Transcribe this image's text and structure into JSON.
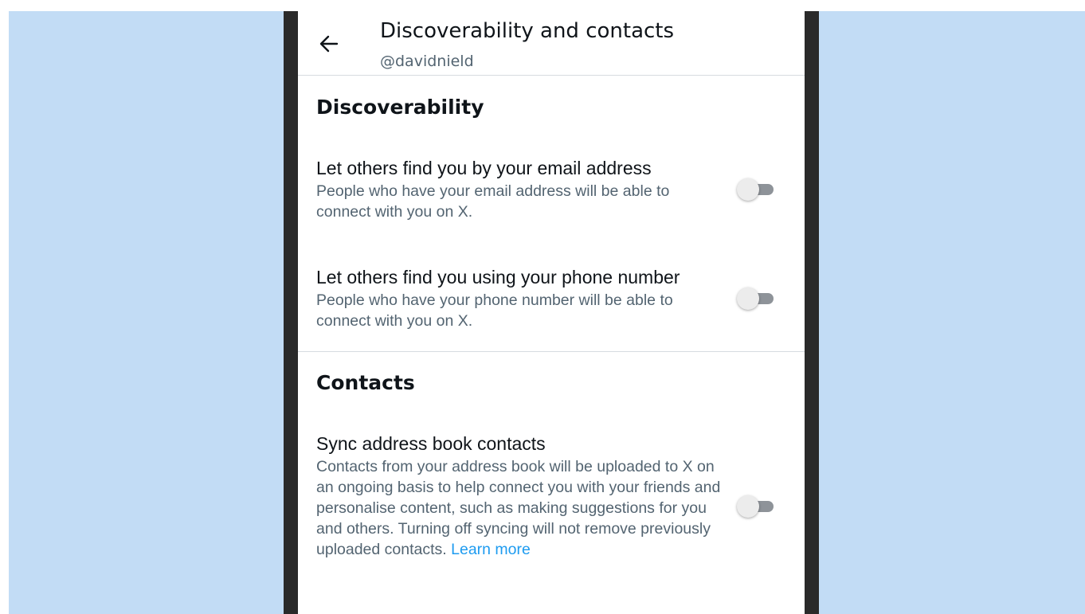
{
  "header": {
    "title": "Discoverability and contacts",
    "username": "@davidnield",
    "back_icon": "arrow-left-icon"
  },
  "discoverability": {
    "title": "Discoverability",
    "settings": [
      {
        "label": "Let others find you by your email address",
        "description": "People who have your email address will be able to connect with you on X.",
        "enabled": false
      },
      {
        "label": "Let others find you using your phone number",
        "description": "People who have your phone number will be able to connect with you on X.",
        "enabled": false
      }
    ]
  },
  "contacts": {
    "title": "Contacts",
    "settings": [
      {
        "label": "Sync address book contacts",
        "description": "Contacts from your address book will be uploaded to X on an ongoing basis to help connect you with your friends and personalise content, such as making suggestions for you and others. Turning off syncing will not remove previously uploaded contacts.",
        "link_text": "Learn more",
        "enabled": false
      }
    ]
  },
  "colors": {
    "background": "#c2dcf5",
    "frame": "#2a2a2a",
    "link": "#1d9bf0",
    "secondary_text": "#536471"
  }
}
